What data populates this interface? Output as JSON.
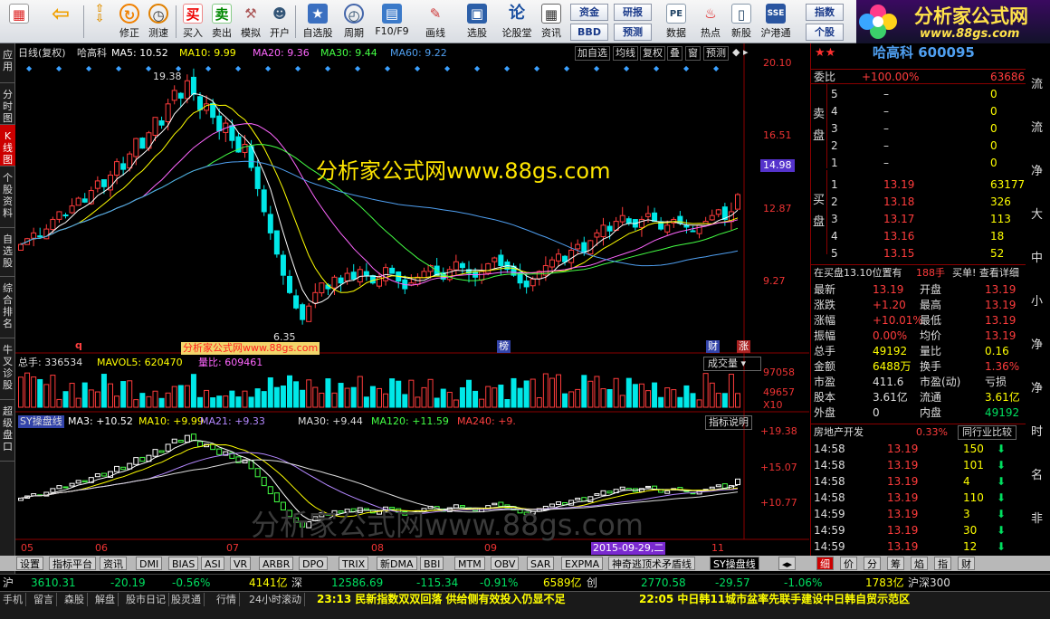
{
  "toolbar": {
    "buttons": [
      {
        "label": "修正",
        "icon": "revise-icon"
      },
      {
        "label": "测速",
        "icon": "speedtest-icon"
      },
      {
        "label": "买入",
        "icon": "buy-icon"
      },
      {
        "label": "卖出",
        "icon": "sell-icon"
      },
      {
        "label": "模拟",
        "icon": "simulate-icon"
      },
      {
        "label": "开户",
        "icon": "open-account-icon"
      },
      {
        "label": "自选股",
        "icon": "watchlist-icon"
      },
      {
        "label": "周期",
        "icon": "period-icon"
      },
      {
        "label": "F10/F9",
        "icon": "f10-icon"
      },
      {
        "label": "画线",
        "icon": "draw-line-icon"
      },
      {
        "label": "选股",
        "icon": "stock-picker-icon"
      },
      {
        "label": "论股堂",
        "icon": "forum-icon"
      },
      {
        "label": "资讯",
        "icon": "news-icon"
      },
      {
        "label": "数据",
        "icon": "data-icon"
      },
      {
        "label": "热点",
        "icon": "hotspot-icon"
      },
      {
        "label": "新股",
        "icon": "new-stock-icon"
      },
      {
        "label": "沪港通",
        "icon": "hk-connect-icon"
      }
    ],
    "buy_glyph": "买",
    "sell_glyph": "卖",
    "forum_glyph": "论",
    "rect_buttons": [
      "资金",
      "研报",
      "BBD",
      "预测",
      "指数",
      "个股"
    ],
    "logo_text": "分析家公式网",
    "logo_url": "www.88gs.com"
  },
  "left_tabs": [
    "应用",
    "分时图",
    "K线图",
    "个股资料",
    "自选股",
    "综合排名",
    "牛叉诊股",
    "超级盘口"
  ],
  "chart": {
    "header": {
      "period": "日线(复权)",
      "name": "哈高科",
      "ma5": "MA5: 10.52",
      "ma10": "MA10: 9.99",
      "ma20": "MA20: 9.36",
      "ma30": "MA30: 9.44",
      "ma60": "MA60: 9.22"
    },
    "header_buttons": [
      "加自选",
      "均线",
      "复权",
      "叠",
      "窗",
      "预测"
    ],
    "watermark": "分析家公式网www.88gs.com",
    "watermark2": "分析家公式网www.88gs.com",
    "axis_labels": [
      "20.10",
      "16.51",
      "14.98",
      "12.87",
      "9.27"
    ],
    "high_label": "19.38",
    "low_label": "6.35",
    "mark_q": "q",
    "mark_bang": "榜",
    "mark_cai": "财",
    "mark_zhang": "涨",
    "vol": {
      "total": "总手: 336534",
      "mavol5": "MAVOL5: 620470",
      "liangbi": "量比: 609461",
      "dropdown": "成交量",
      "axis": [
        "97058",
        "49657",
        "X10"
      ]
    },
    "ind": {
      "name": "SY操盘线",
      "ma3": "MA3: +10.52",
      "ma10": "MA10: +9.99",
      "ma21": "MA21: +9.33",
      "ma30": "MA30: +9.44",
      "ma120": "MA120: +11.59",
      "ma240": "MA240: +9.",
      "explain": "指标说明",
      "axis": [
        "+19.38",
        "+15.07",
        "+10.77"
      ]
    },
    "x_months": [
      "05",
      "06",
      "07",
      "08",
      "09",
      "11"
    ],
    "date_tag": "2015-09-29,二",
    "candles": []
  },
  "chart_data": {
    "type": "candlestick",
    "title": "哈高科 日线(复权)",
    "ylim": [
      6,
      20.1
    ],
    "close": [
      10.6,
      10.9,
      11.2,
      11.0,
      11.4,
      11.9,
      12.3,
      12.1,
      12.6,
      13.0,
      12.8,
      13.4,
      13.9,
      13.6,
      14.2,
      14.9,
      14.5,
      15.3,
      16.1,
      15.6,
      16.4,
      17.2,
      16.8,
      17.9,
      18.6,
      18.2,
      19.1,
      18.4,
      17.6,
      17.9,
      17.2,
      16.5,
      16.9,
      16.0,
      15.4,
      15.8,
      14.6,
      13.5,
      12.3,
      11.2,
      10.1,
      9.0,
      8.1,
      7.3,
      6.7,
      7.4,
      8.1,
      8.6,
      8.3,
      8.9,
      8.6,
      9.1,
      8.8,
      9.3,
      9.0,
      8.6,
      8.9,
      9.4,
      9.1,
      8.7,
      8.3,
      8.6,
      8.9,
      9.2,
      9.5,
      9.0,
      8.8,
      9.3,
      9.7,
      9.4,
      9.1,
      8.9,
      9.2,
      9.6,
      9.9,
      9.5,
      9.3,
      9.0,
      8.6,
      8.4,
      8.8,
      9.2,
      9.5,
      9.8,
      10.1,
      9.7,
      10.3,
      10.6,
      10.2,
      10.8,
      11.2,
      11.6,
      11.3,
      11.8,
      12.1,
      11.7,
      11.5,
      11.9,
      12.2,
      11.8,
      11.4,
      11.6,
      11.9,
      11.7,
      11.5,
      11.3,
      11.6,
      11.8,
      12.1,
      12.4,
      11.9,
      12.3,
      13.19
    ],
    "price_axis": [
      20.1,
      16.51,
      14.98,
      12.87,
      9.27
    ]
  },
  "quote": {
    "stars": "★★",
    "title": "哈高科 600095",
    "weibi_label": "委比",
    "weibi_val": "+100.00%",
    "weicha_val": "63686",
    "sell_side": "卖盘",
    "buy_side": "买盘",
    "asks": [
      [
        "5",
        "–",
        "0"
      ],
      [
        "4",
        "–",
        "0"
      ],
      [
        "3",
        "–",
        "0"
      ],
      [
        "2",
        "–",
        "0"
      ],
      [
        "1",
        "–",
        "0"
      ]
    ],
    "bids": [
      [
        "1",
        "13.19",
        "63177"
      ],
      [
        "2",
        "13.18",
        "326"
      ],
      [
        "3",
        "13.17",
        "113"
      ],
      [
        "4",
        "13.16",
        "18"
      ],
      [
        "5",
        "13.15",
        "52"
      ]
    ],
    "order_note": "在买盘13.10位置有",
    "order_vol": "188手",
    "order_link": "买单! 查看详细",
    "stats": [
      [
        "最新",
        "13.19",
        "开盘",
        "13.19"
      ],
      [
        "涨跌",
        "+1.20",
        "最高",
        "13.19"
      ],
      [
        "涨幅",
        "+10.01%",
        "最低",
        "13.19"
      ],
      [
        "振幅",
        "0.00%",
        "均价",
        "13.19"
      ],
      [
        "总手",
        "49192",
        "量比",
        "0.16"
      ],
      [
        "金额",
        "6488万",
        "换手",
        "1.36%"
      ],
      [
        "市盈",
        "411.6",
        "市盈(动)",
        "亏损"
      ],
      [
        "股本",
        "3.61亿",
        "流通",
        "3.61亿"
      ],
      [
        "外盘",
        "0",
        "内盘",
        "49192"
      ]
    ],
    "sector": "房地产开发",
    "sector_pct": "0.33%",
    "sector_cmp": "同行业比较",
    "ticks": [
      [
        "14:58",
        "13.19",
        "150"
      ],
      [
        "14:58",
        "13.19",
        "101"
      ],
      [
        "14:58",
        "13.19",
        "4"
      ],
      [
        "14:58",
        "13.19",
        "110"
      ],
      [
        "14:59",
        "13.19",
        "3"
      ],
      [
        "14:59",
        "13.19",
        "30"
      ],
      [
        "14:59",
        "13.19",
        "12"
      ]
    ],
    "right_edge": [
      "流",
      "流",
      "净",
      "大",
      "中",
      "小",
      "净",
      "净",
      "时",
      "名",
      "非"
    ]
  },
  "bottom_tabs": [
    "设置",
    "指标平台",
    "资讯",
    "DMI",
    "BIAS",
    "ASI",
    "VR",
    "ARBR",
    "DPO",
    "TRIX",
    "新DMA",
    "BBI",
    "MTM",
    "OBV",
    "SAR",
    "EXPMA",
    "神奇逃顶术矛盾线",
    "SY操盘线"
  ],
  "right_bottom_tabs": [
    "细",
    "价",
    "分",
    "筹",
    "焰",
    "指",
    "财"
  ],
  "index_bar": {
    "sh_name": "沪",
    "sh_val": "3610.31",
    "sh_chg": "-20.19",
    "sh_pct": "-0.56%",
    "sh_amt": "4141亿",
    "sz_name": "深",
    "sz_val": "12586.69",
    "sz_chg": "-115.34",
    "sz_pct": "-0.91%",
    "sz_amt": "6589亿",
    "cy_name": "创",
    "cy_val": "2770.58",
    "cy_chg": "-29.57",
    "cy_pct": "-1.06%",
    "cy_amt": "1783亿",
    "hs_name": "沪深300"
  },
  "news_bar": {
    "buttons": [
      "手机",
      "留言",
      "森股",
      "解盘",
      "股市日记",
      "股灵通",
      "行情",
      "24小时滚动"
    ],
    "news1": "23:13 民新指数双双回落 供给侧有效投入仍显不足",
    "news2": "22:05 中日韩11城市盆率先联手建设中日韩自贸示范区"
  },
  "colors": {
    "up": "#ff3c3c",
    "down": "#00e8e8",
    "ma5": "#ffffff",
    "ma10": "#ffff00",
    "ma20": "#ff66ff",
    "ma30": "#44ff44",
    "ma60": "#4f9ff0"
  }
}
